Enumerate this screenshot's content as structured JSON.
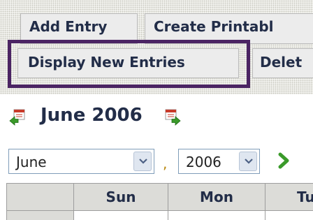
{
  "tabs": {
    "add_entry": "Add Entry",
    "create_printable": "Create Printabl",
    "display_new_entries": "Display New Entries",
    "delete": "Delet"
  },
  "calendar": {
    "title": "June 2006",
    "prev_icon": "calendar-prev-arrow-icon",
    "next_icon": "calendar-next-arrow-icon",
    "month_select": {
      "value": "June"
    },
    "separator": ",",
    "year_select": {
      "value": "2006"
    },
    "go_icon": "go-arrow-icon",
    "weekday_headers": [
      "",
      "Sun",
      "Mon",
      "Tu"
    ]
  },
  "colors": {
    "highlight": "#4b2463",
    "tab_text": "#222d48",
    "go_arrow": "#3a9a2a"
  }
}
